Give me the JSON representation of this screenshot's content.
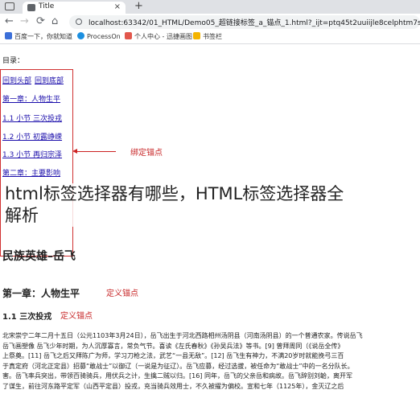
{
  "tab": {
    "title": "Title",
    "close": "×",
    "new_tab": "+"
  },
  "toolbar": {
    "back": "←",
    "forward": "→",
    "reload": "⟳",
    "home": "⌂",
    "url": "localhost:63342/01_HTML/Demo05_超链接标签_a_锚点_1.html?_ijt=ptq45t2uuiijle8celphtm7so"
  },
  "bookmarks": [
    {
      "label": "百度一下，你就知道",
      "color": "#3b6fd8"
    },
    {
      "label": "ProcessOn",
      "color": "#1b8fe0"
    },
    {
      "label": "个人中心 - 迅捷画图",
      "color": "#e2574c"
    },
    {
      "label": "书签栏",
      "color": "#f4b400"
    }
  ],
  "toc": {
    "label": "目录：",
    "links": [
      {
        "a": "回到头部",
        "b": "回到底部"
      },
      {
        "a": "第一章：人物生平"
      },
      {
        "a": "1.1 小节 三次投戎"
      },
      {
        "a": "1.2 小节 初露峥嵘"
      },
      {
        "a": "1.3 小节 再归宗泽"
      },
      {
        "a": "第二章：主要影响"
      }
    ]
  },
  "annotations": {
    "bind_anchor": "绑定锚点",
    "define_anchor_1": "定义锚点",
    "define_anchor_2": "定义锚点"
  },
  "overlay": {
    "line1": "html标签选择器有哪些，HTML标签选择器全",
    "line2": "解析"
  },
  "article": {
    "title": "民族英雄–岳飞",
    "chapter": "第一章：人物生平",
    "section": "1.1 三次投戎",
    "lines": [
      "北宋崇宁二年二月十五日（公元1103年3月24日），岳飞出生于河北西路相州汤阴县（河南汤阴县）的一个普通农家。传说岳飞",
      "岳飞画塑像 岳飞少年时期，为人沉厚寡言，常负气节。喜读《左氏春秋》《孙吴兵法》等书。[9] 曾拜周同（《说岳全传》",
      "上祭奠。[11] 岳飞之后又拜陈广为师，学习刀枪之法，武艺“一县无敌”。[12] 岳飞生有神力，不满20岁时就能挽弓三百",
      "于真定府（河北正定县）招募“敢战士”以御辽（一说是为征辽）。岳飞应募，经过选拔，被任命为“敢战士”中的一名分队长。",
      "害。岳飞率兵突出，带领百骑骑兵，用伏兵之计，生擒二贼以归。[16] 同年，岳飞的父亲岳和病故。岳飞辞别刘韐，离开军",
      "了谋生，前往河东路平定军（山西平定县）投戎，充当骑兵效用士，不久被擢为偏校。宣和七年（1125年），金灭辽之后"
    ]
  }
}
